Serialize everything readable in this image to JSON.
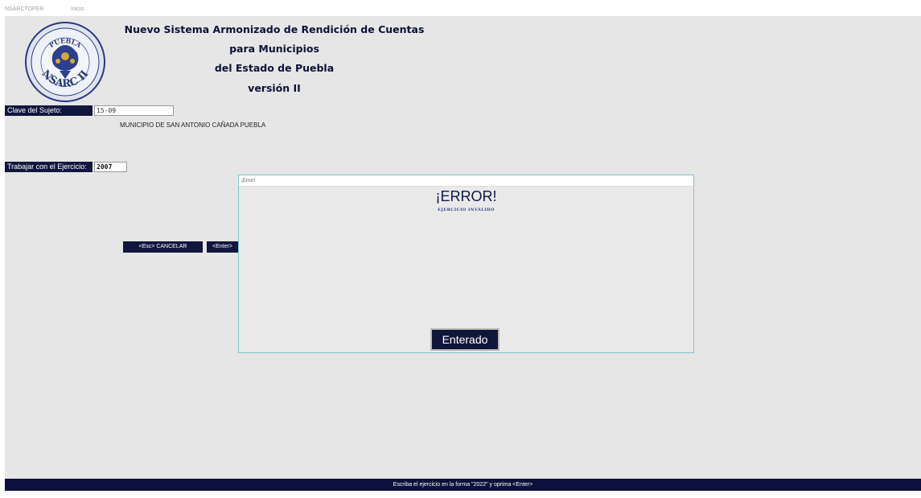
{
  "titlebar": {
    "app": "NSARCTOPER",
    "section": "Inicio"
  },
  "header": {
    "line1": "Nuevo Sistema Armonizado de Rendición de Cuentas",
    "line2": "para Municipios",
    "line3": "del Estado de Puebla",
    "line4": "versión II"
  },
  "logo": {
    "top_text": "PUEBLA",
    "bottom_text": "NSARC II"
  },
  "form": {
    "sujeto_label": "Clave del Sujeto:",
    "sujeto_value": "15-09",
    "municipio": "MUNICIPIO DE SAN ANTONIO CAÑADA PUEBLA",
    "ejercicio_label": "Trabajar con el Ejercicio:",
    "ejercicio_value": "2007"
  },
  "buttons": {
    "cancel": "<Esc>  CANCELAR",
    "enter": "<Enter>"
  },
  "dialog": {
    "title": "¡Error!",
    "heading": "¡ERROR!",
    "message": "EJERCICIO INVÁLIDO",
    "ok": "Enterado"
  },
  "status": {
    "text": "Escriba el ejercicio en la forma \"2022\" y oprima <Enter>"
  },
  "colors": {
    "navy": "#11163f",
    "panel": "#e6e6e6",
    "dialog_border": "#7fc5cf"
  }
}
